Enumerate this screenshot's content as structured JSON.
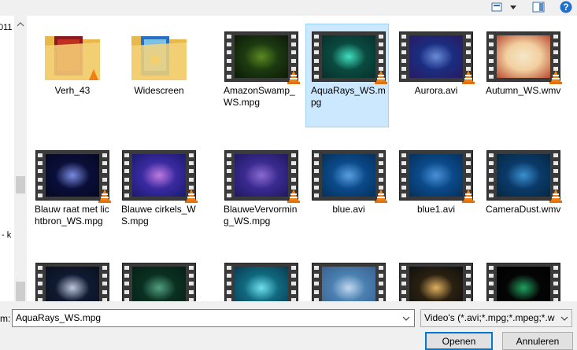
{
  "toolbar": {
    "view_icon": "change-view-icon",
    "preview_icon": "preview-pane-icon",
    "help_icon": "help-icon",
    "help_label": "?"
  },
  "left_pane": {
    "fragment_top": "011",
    "fragment_mid": "- k"
  },
  "items": [
    {
      "name": "Verh_43",
      "kind": "folder"
    },
    {
      "name": "Widescreen",
      "kind": "folder"
    },
    {
      "name": "AmazonSwamp_WS.mpg",
      "kind": "video",
      "colors": [
        "#1c3a10",
        "#5b8a22",
        "#0c1a08"
      ]
    },
    {
      "name": "AquaRays_WS.mpg",
      "kind": "video",
      "colors": [
        "#0a4a40",
        "#3fe0c0",
        "#07302a"
      ],
      "selected": true
    },
    {
      "name": "Aurora.avi",
      "kind": "video",
      "colors": [
        "#1a2d80",
        "#6a8ad8",
        "#2a1a60"
      ]
    },
    {
      "name": "Autumn_WS.wmv",
      "kind": "video",
      "colors": [
        "#f2d0a0",
        "#f5e6c8",
        "#b84a30"
      ]
    },
    {
      "name": "Blauw raat met lichtbron_WS.mpg",
      "kind": "video",
      "colors": [
        "#0a0f3a",
        "#7a8ae0",
        "#050820"
      ]
    },
    {
      "name": "Blauwe cirkels_WS.mpg",
      "kind": "video",
      "colors": [
        "#3a2aa0",
        "#c07ae0",
        "#1a1a70"
      ]
    },
    {
      "name": "BlauweVervorming_WS.mpg",
      "kind": "video",
      "colors": [
        "#3a2a90",
        "#8a6ad0",
        "#201860"
      ]
    },
    {
      "name": "blue.avi",
      "kind": "video",
      "colors": [
        "#0a4a8a",
        "#5aa0e0",
        "#07305a"
      ]
    },
    {
      "name": "blue1.avi",
      "kind": "video",
      "colors": [
        "#0a4a8a",
        "#4a90d8",
        "#07305a"
      ]
    },
    {
      "name": "CameraDust.wmv",
      "kind": "video",
      "colors": [
        "#0a3a6a",
        "#3a90d0",
        "#062840"
      ]
    },
    {
      "name": "",
      "kind": "video",
      "colors": [
        "#101a30",
        "#c0c8e0",
        "#0a1020"
      ]
    },
    {
      "name": "",
      "kind": "video",
      "colors": [
        "#0a3020",
        "#50a080",
        "#062018"
      ]
    },
    {
      "name": "",
      "kind": "video",
      "colors": [
        "#106a80",
        "#70e0f0",
        "#0a3a50"
      ]
    },
    {
      "name": "",
      "kind": "video",
      "colors": [
        "#4a80b0",
        "#c0d8f0",
        "#3a6090"
      ]
    },
    {
      "name": "",
      "kind": "video",
      "colors": [
        "#2a2010",
        "#e0b060",
        "#101010"
      ]
    },
    {
      "name": "",
      "kind": "video",
      "colors": [
        "#050505",
        "#20a060",
        "#000000"
      ]
    }
  ],
  "footer": {
    "filename_label": "m:",
    "filename_value": "AquaRays_WS.mpg",
    "filetype_value": "Video's (*.avi;*.mpg;*.mpeg;*.w",
    "open_label": "Openen",
    "cancel_label": "Annuleren"
  }
}
